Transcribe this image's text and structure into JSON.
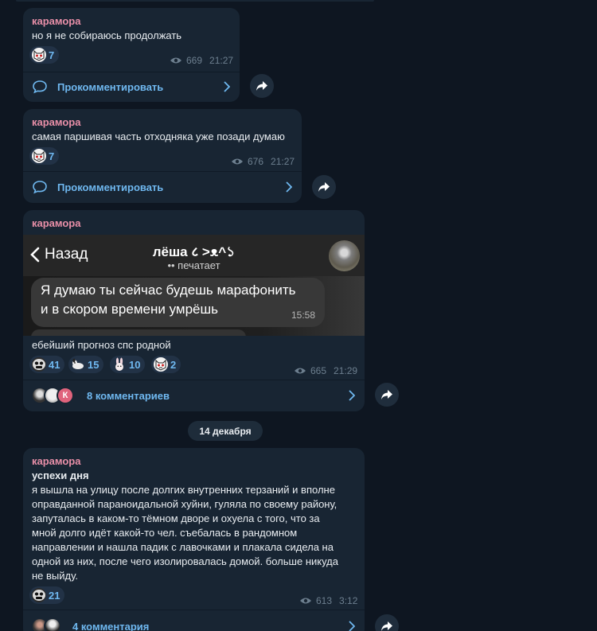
{
  "colors": {
    "background": "#0e1621",
    "bubble": "#182533",
    "author": "#e88fa8",
    "link": "#6fb8f0",
    "meta": "#6d7f8f"
  },
  "posts": [
    {
      "author": "карамора",
      "text": "но я не собираюсь продолжать",
      "reactions": [
        {
          "icon": "cat-mask-emoji",
          "count": "7"
        }
      ],
      "views": "669",
      "time": "21:27",
      "comment_label": "Прокомментировать"
    },
    {
      "author": "карамора",
      "text": "самая паршивая часть отходняка уже позади думаю",
      "reactions": [
        {
          "icon": "cat-mask-emoji",
          "count": "7"
        }
      ],
      "views": "676",
      "time": "21:27",
      "comment_label": "Прокомментировать"
    },
    {
      "author": "карамора",
      "screenshot": {
        "back_label": "Назад",
        "contact_name": "лёша ८ >ᴥ^১",
        "status": "•• печатает",
        "message_line1": "Я думаю ты сейчас будешь марафонить",
        "message_line2": "и в скором времени умрёшь",
        "message_time": "15:58"
      },
      "text": "ебейший прогноз спс родной",
      "reactions": [
        {
          "icon": "skull-face-emoji",
          "count": "41"
        },
        {
          "icon": "dog-emoji",
          "count": "15"
        },
        {
          "icon": "bunny-emoji",
          "count": "10"
        },
        {
          "icon": "cat-mask-emoji",
          "count": "2"
        }
      ],
      "views": "665",
      "time": "21:29",
      "commenter_initial": "К",
      "comment_label": "8 комментариев"
    },
    {
      "author": "карамора",
      "title": "успехи дня",
      "lines": [
        "я вышла на улицу после долгих внутренних терзаний и вполне",
        "оправданной параноидальной хуйни, гуляла по своему району,",
        "запуталась в каком-то тёмном дворе и охуела с того, что за",
        "мной долго идёт какой-то чел. съебалась в рандомном",
        "направлении и нашла падик с лавочками и плакала сидела на",
        "одной из них, после чего изолировалась домой. больше никуда",
        "не выйду."
      ],
      "reactions": [
        {
          "icon": "skull-face-emoji",
          "count": "21"
        }
      ],
      "views": "613",
      "time": "3:12",
      "comment_label": "4 комментария"
    }
  ],
  "date_separator": "14 декабря"
}
